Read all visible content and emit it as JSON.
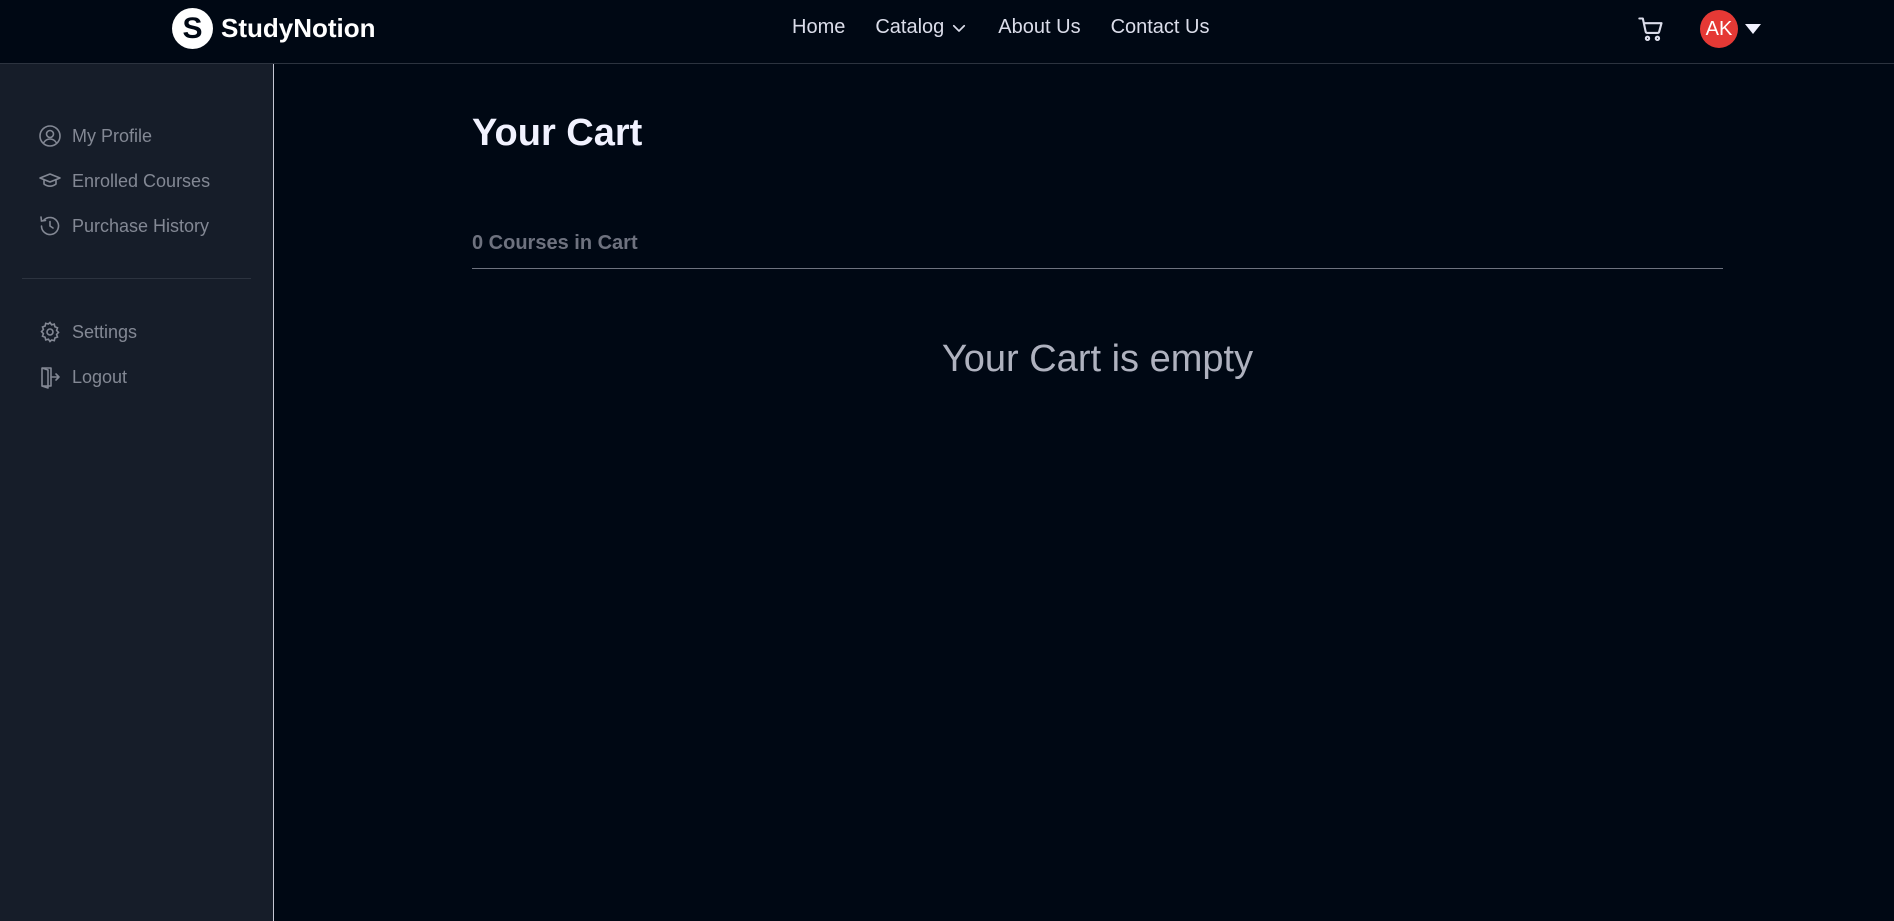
{
  "brand": {
    "logo_letter": "S",
    "name": "StudyNotion"
  },
  "nav": {
    "home": "Home",
    "catalog": "Catalog",
    "about": "About Us",
    "contact": "Contact Us"
  },
  "header": {
    "avatar_initials": "AK"
  },
  "sidebar": {
    "items": [
      {
        "label": "My Profile",
        "icon": "user-circle-icon"
      },
      {
        "label": "Enrolled Courses",
        "icon": "graduation-cap-icon"
      },
      {
        "label": "Purchase History",
        "icon": "history-icon"
      },
      {
        "label": "Settings",
        "icon": "gear-icon"
      },
      {
        "label": "Logout",
        "icon": "logout-icon"
      }
    ]
  },
  "main": {
    "title": "Your Cart",
    "count_text": "0 Courses in Cart",
    "empty_text": "Your Cart is empty"
  },
  "colors": {
    "background": "#000814",
    "sidebar": "#161D29",
    "avatar": "#E53935"
  }
}
